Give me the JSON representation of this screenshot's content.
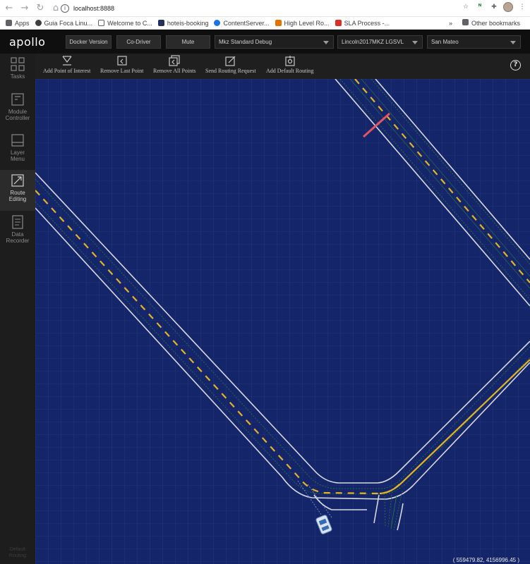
{
  "browser": {
    "url": "localhost:8888",
    "bookmarks": [
      {
        "label": "Apps",
        "color": "#5f6368"
      },
      {
        "label": "Guia Foca Linu...",
        "color": "#3c4043"
      },
      {
        "label": "Welcome to C...",
        "color": "#5f6368"
      },
      {
        "label": "hoteis-booking",
        "color": "#24305e"
      },
      {
        "label": "ContentServer...",
        "color": "#1a73e8"
      },
      {
        "label": "High Level Ro...",
        "color": "#e37400"
      },
      {
        "label": "SLA Process -...",
        "color": "#d93025"
      }
    ],
    "more_bookmarks": "»",
    "other_bookmarks": "Other bookmarks"
  },
  "header": {
    "logo": "apollo",
    "buttons": [
      "Docker Version",
      "Co-Driver",
      "Mute"
    ],
    "mode_select": "Mkz Standard Debug",
    "vehicle_select": "Lincoln2017MKZ LGSVL",
    "map_select": "San Mateo"
  },
  "sidebar": {
    "items": [
      {
        "label_1": "Tasks",
        "label_2": "",
        "icon": "grid-icon"
      },
      {
        "label_1": "Module",
        "label_2": "Controller",
        "icon": "module-icon"
      },
      {
        "label_1": "Layer",
        "label_2": "Menu",
        "icon": "layers-icon"
      },
      {
        "label_1": "Route",
        "label_2": "Editing",
        "icon": "route-icon",
        "active": true
      },
      {
        "label_1": "Data",
        "label_2": "Recorder",
        "icon": "document-icon"
      }
    ],
    "default_routing_1": "Default",
    "default_routing_2": "Routing"
  },
  "toolbar": {
    "tools": [
      {
        "label": "Add Point of Interest",
        "icon": "add-point-icon"
      },
      {
        "label": "Remove Last Point",
        "icon": "undo-icon"
      },
      {
        "label": "Remove All Points",
        "icon": "remove-all-icon"
      },
      {
        "label": "Send Routing Request",
        "icon": "send-icon"
      },
      {
        "label": "Add Default Routing",
        "icon": "default-routing-icon"
      }
    ],
    "help": "?"
  },
  "map": {
    "coordinates": "( 559479.82, 4156996.45 )",
    "colors": {
      "background": "#15256a",
      "grid": "#3a4c8c",
      "road_edge": "#d8d8e0",
      "lane_center": "#e4b520",
      "lane_guide": "#2b7a3c",
      "stop_line": "#e25466"
    }
  }
}
